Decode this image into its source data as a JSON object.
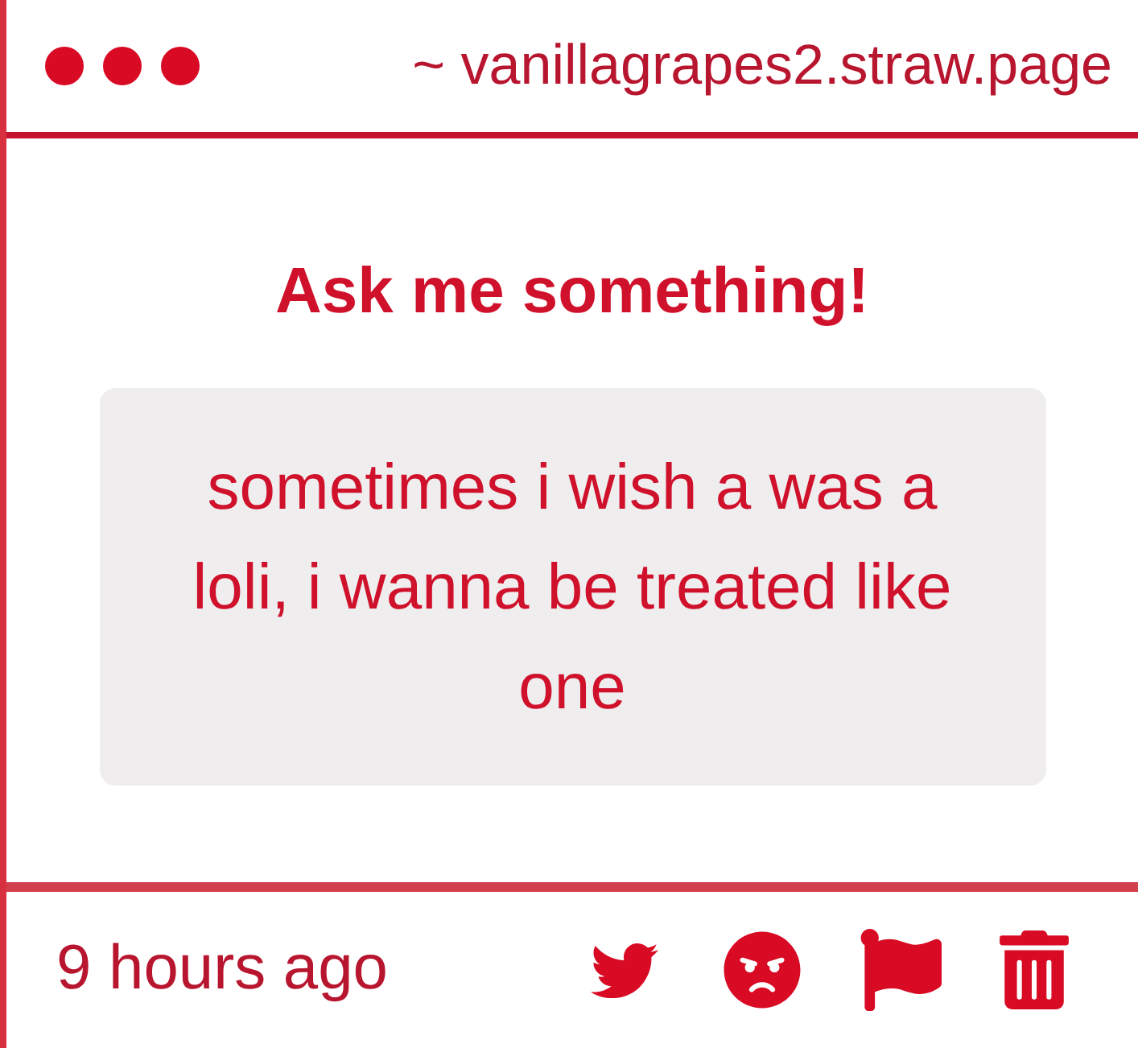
{
  "window": {
    "url": "~ vanillagrapes2.straw.page"
  },
  "card": {
    "title": "Ask me something!",
    "question": "sometimes i wish a was a loli, i wanna be treated like one"
  },
  "footer": {
    "time": "9 hours ago"
  }
}
